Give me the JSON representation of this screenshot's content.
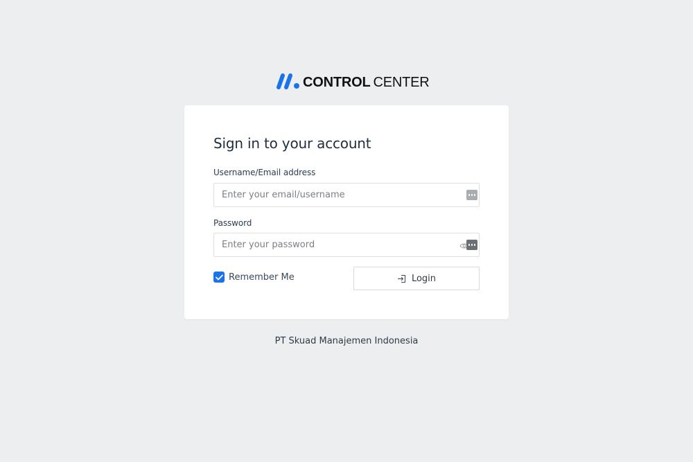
{
  "brand": {
    "name_bold": "CONTROL",
    "name_light": "CENTER",
    "accent_color": "#1a73e8"
  },
  "login_card": {
    "title": "Sign in to your account",
    "username": {
      "label": "Username/Email address",
      "placeholder": "Enter your email/username",
      "value": ""
    },
    "password": {
      "label": "Password",
      "placeholder": "Enter your password",
      "value": ""
    },
    "remember_me": {
      "label": "Remember Me",
      "checked": true
    },
    "login_button": {
      "label": "Login",
      "icon": "login-icon"
    }
  },
  "footer": {
    "company": "PT Skuad Manajemen Indonesia"
  }
}
